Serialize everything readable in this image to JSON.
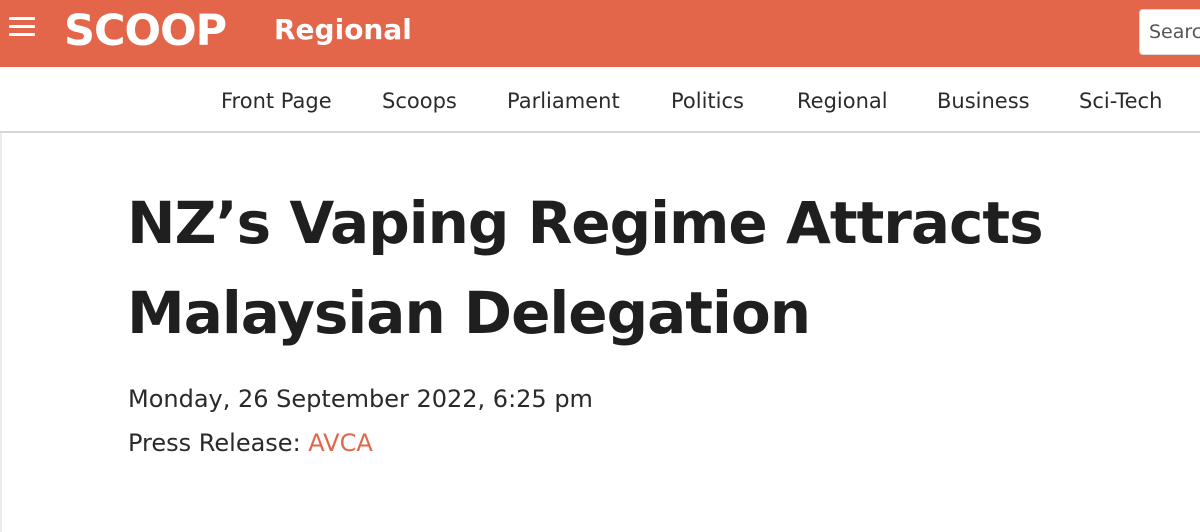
{
  "header": {
    "menu_icon": "hamburger-menu-icon",
    "logo_text": "SCOOP",
    "section": "Regional",
    "search_placeholder": "Search",
    "brand_color": "#e4664a"
  },
  "nav": {
    "items": [
      "Front Page",
      "Scoops",
      "Parliament",
      "Politics",
      "Regional",
      "Business",
      "Sci-Tech"
    ]
  },
  "article": {
    "headline": "NZ’s Vaping Regime Attracts Malaysian Delegation",
    "date": "Monday, 26 September 2022, 6:25 pm",
    "source_label": "Press Release: ",
    "source_name": "AVCA",
    "link_color": "#e4664a"
  }
}
